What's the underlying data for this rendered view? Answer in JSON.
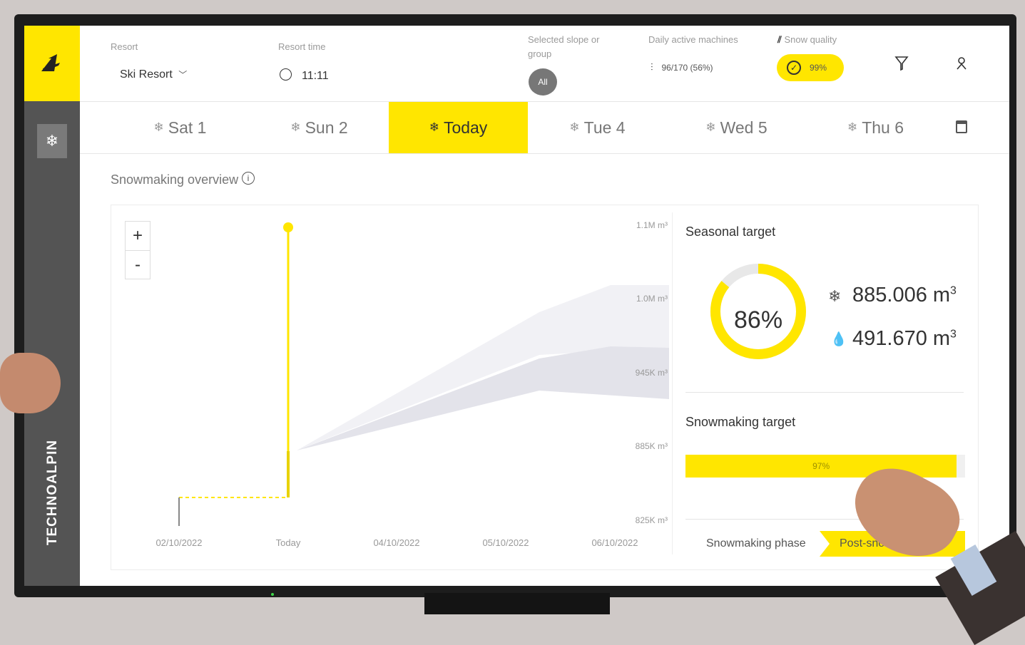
{
  "header": {
    "resort_label": "Resort",
    "resort_value": "Ski Resort",
    "time_label": "Resort time",
    "time_value": "11:11",
    "slope_label_line1": "Selected slope or",
    "slope_label_line2": "group",
    "slope_value": "All",
    "machines_label": "Daily active machines",
    "machines_value": "96/170 (56%)",
    "quality_label": "Snow quality",
    "quality_value": "99%"
  },
  "tabs": [
    {
      "label": "Sat 1"
    },
    {
      "label": "Sun 2"
    },
    {
      "label": "Today"
    },
    {
      "label": "Tue 4"
    },
    {
      "label": "Wed 5"
    },
    {
      "label": "Thu 6"
    }
  ],
  "overview": {
    "title": "Snowmaking overview",
    "zoom_in": "+",
    "zoom_out": "-"
  },
  "chart_data": {
    "type": "area",
    "x_ticks": [
      "02/10/2022",
      "Today",
      "04/10/2022",
      "05/10/2022",
      "06/10/2022"
    ],
    "y_ticks": [
      "1.1M m³",
      "1.0M m³",
      "945K m³",
      "885K m³",
      "825K m³"
    ]
  },
  "seasonal": {
    "title": "Seasonal target",
    "percent": "86%",
    "percent_value": 0.86,
    "snow_volume": "885.006 m",
    "water_volume": "491.670 m",
    "unit_sup": "3"
  },
  "snowmaking_target": {
    "title": "Snowmaking target",
    "percent": "97%",
    "percent_value": 0.97
  },
  "phase": {
    "label": "Snowmaking phase",
    "value": "Post-snow"
  },
  "brand": "TECHNOALPIN",
  "colors": {
    "accent": "#ffe600",
    "sidebar": "#545454"
  }
}
